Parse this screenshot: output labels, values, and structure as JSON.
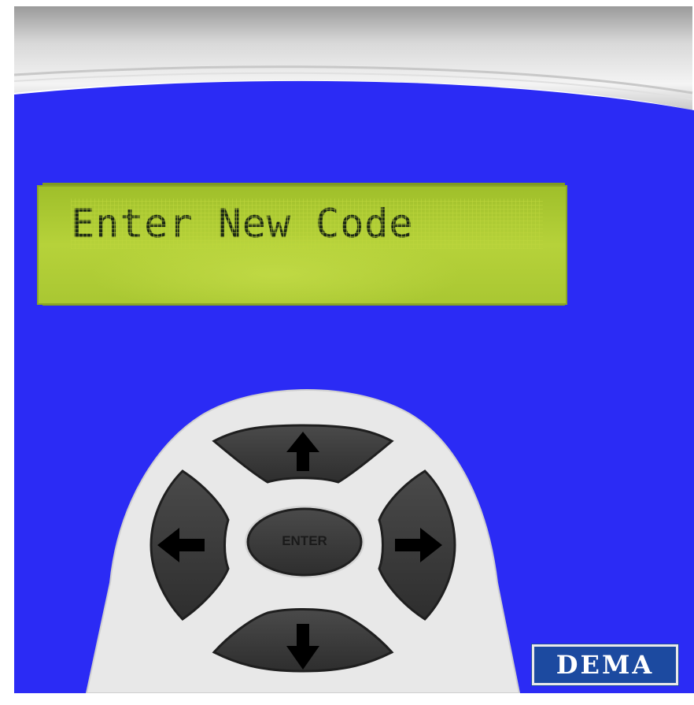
{
  "display": {
    "text": "Enter New Code"
  },
  "keypad": {
    "up_icon": "arrow-up-icon",
    "down_icon": "arrow-down-icon",
    "left_icon": "arrow-left-icon",
    "right_icon": "arrow-right-icon",
    "enter_label": "ENTER"
  },
  "brand": {
    "logo_text": "DEMA",
    "logo_color": "#1c4aa0"
  },
  "colors": {
    "panel_blue": "#2b2bf5",
    "lcd_green": "#b8d43a",
    "key_gray": "#3d3d3d",
    "keypad_surround": "#e8e8e8"
  }
}
